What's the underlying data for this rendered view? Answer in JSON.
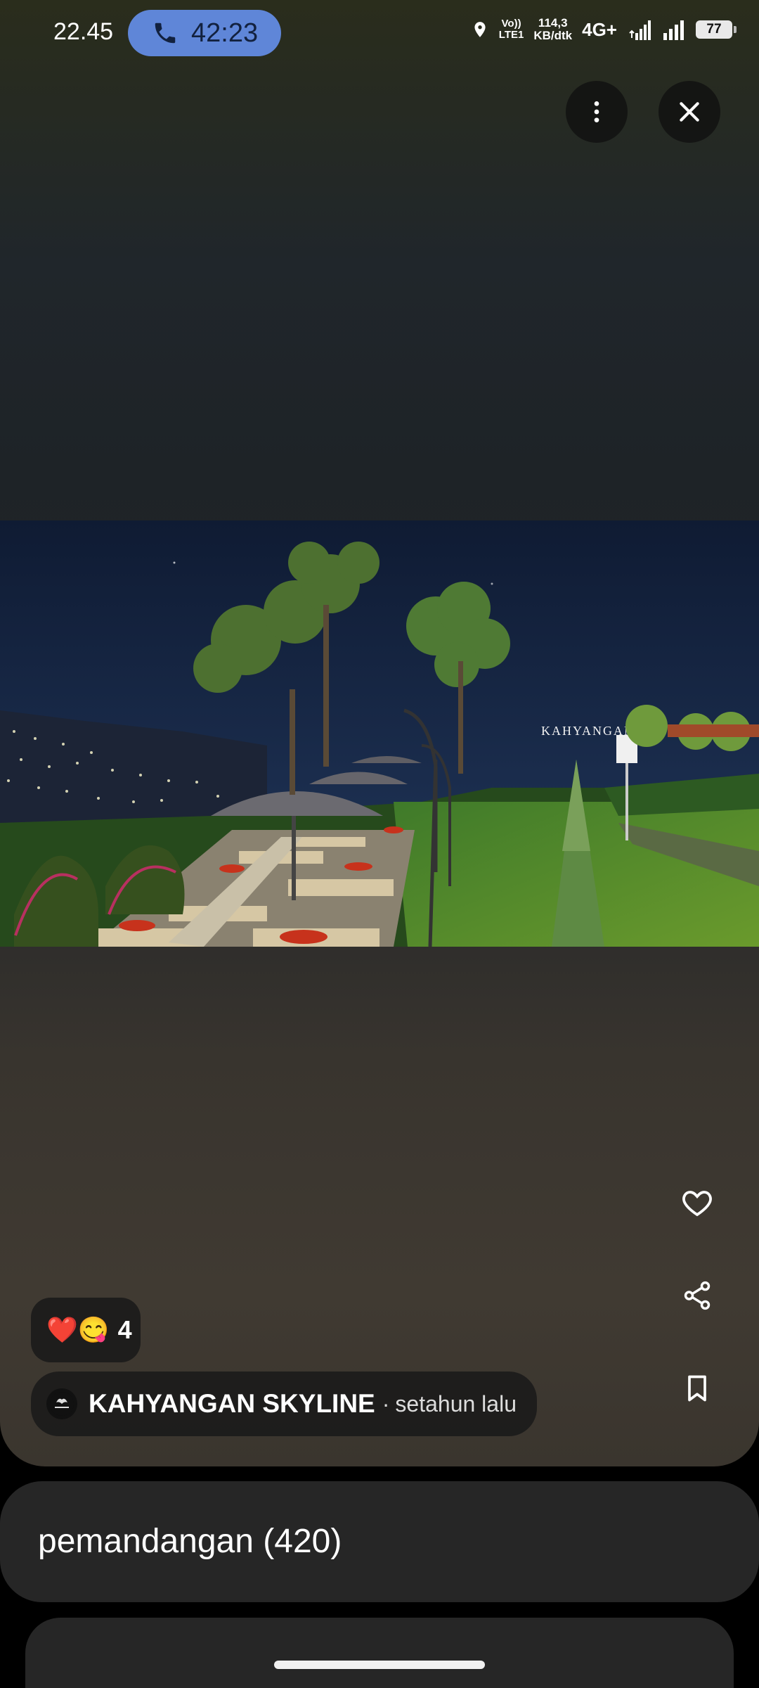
{
  "status_bar": {
    "time": "22.45",
    "call_timer": "42:23",
    "volte_line1": "Vo))",
    "volte_line2": "LTE1",
    "speed_line1": "114,3",
    "speed_line2": "KB/dtk",
    "network": "4G+",
    "battery": "77"
  },
  "viewer": {
    "reactions": {
      "emoji": "❤️😋",
      "count": "4"
    },
    "source": {
      "name": "KAHYANGAN SKYLINE",
      "separator": "·",
      "time_ago": "setahun lalu"
    },
    "photo_sign": "KAHYANGAN"
  },
  "album": {
    "label": "pemandangan (420)"
  },
  "colors": {
    "call_pill": "#5f86d8",
    "card_bg": "#262626"
  },
  "icons": [
    "phone-icon",
    "location-icon",
    "more-vert-icon",
    "close-icon",
    "heart-icon",
    "share-icon",
    "bookmark-icon"
  ]
}
